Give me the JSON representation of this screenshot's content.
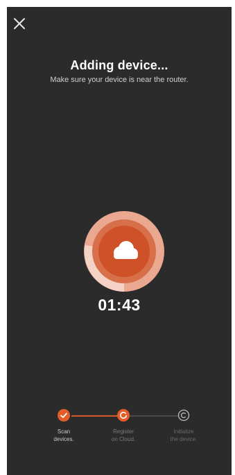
{
  "header": {
    "close_icon": "close-icon",
    "title": "Adding device...",
    "subtitle": "Make sure your device is near the router."
  },
  "progress": {
    "icon": "cloud-icon",
    "timer": "01:43",
    "accent_color": "#e45c2a",
    "ring_color": "#f2c2b0"
  },
  "steps": [
    {
      "label": "Scan\ndevices.",
      "state": "done",
      "icon": "check-icon"
    },
    {
      "label": "Register\non Cloud.",
      "state": "active",
      "icon": "spinner-icon"
    },
    {
      "label": "Initialize\nthe device.",
      "state": "pending",
      "icon": "pending-circle-icon"
    }
  ],
  "colors": {
    "background": "#2b2b2b",
    "accent": "#e45c2a"
  }
}
